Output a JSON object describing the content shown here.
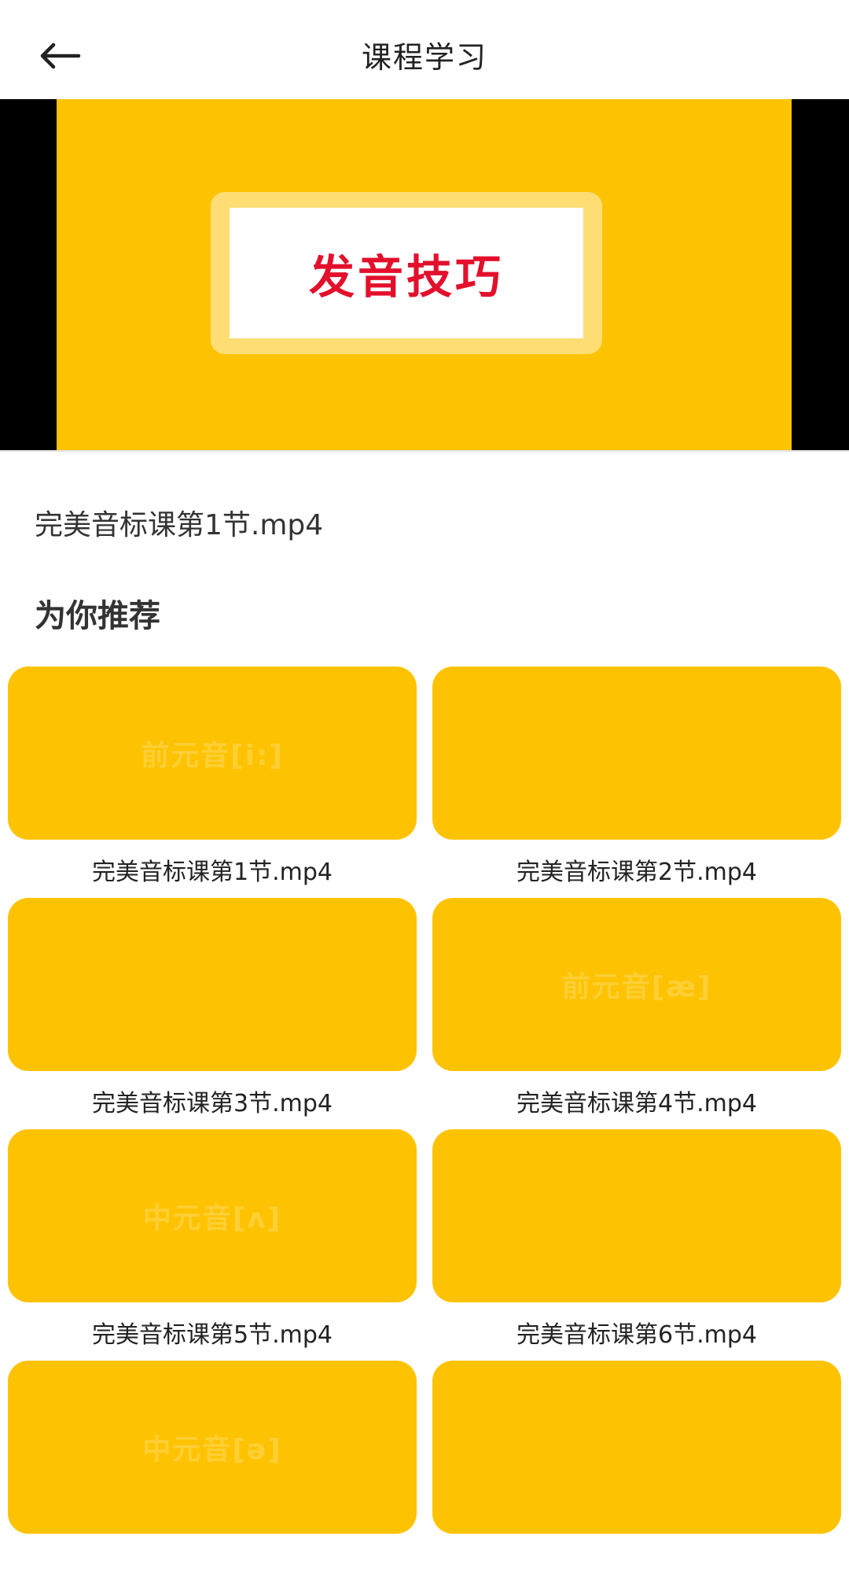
{
  "header": {
    "back_icon": "arrow-left-icon",
    "title": "课程学习"
  },
  "video": {
    "card_text": "发音技巧",
    "colors": {
      "background": "#FDC302",
      "side_bars": "#000000",
      "card_text": "#E3102C"
    }
  },
  "current_file": "完美音标课第1节.mp4",
  "recommend": {
    "title": "为你推荐",
    "items": [
      {
        "label": "完美音标课第1节.mp4",
        "watermark": "前元音[i:]"
      },
      {
        "label": "完美音标课第2节.mp4",
        "watermark": ""
      },
      {
        "label": "完美音标课第3节.mp4",
        "watermark": ""
      },
      {
        "label": "完美音标课第4节.mp4",
        "watermark": "前元音[æ]"
      },
      {
        "label": "完美音标课第5节.mp4",
        "watermark": "中元音[ʌ]"
      },
      {
        "label": "完美音标课第6节.mp4",
        "watermark": ""
      },
      {
        "label": "",
        "watermark": "中元音[ə]"
      },
      {
        "label": "",
        "watermark": ""
      }
    ]
  },
  "colors": {
    "accent": "#FDC302"
  }
}
